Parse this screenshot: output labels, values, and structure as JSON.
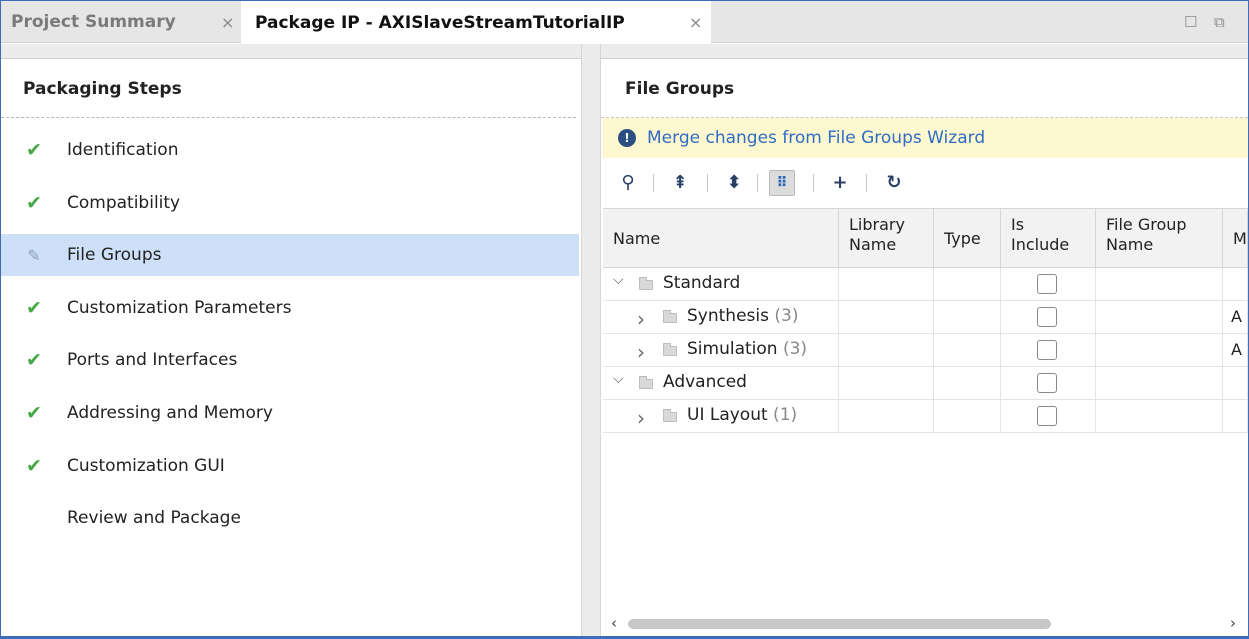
{
  "tabs": [
    {
      "label": "Project Summary",
      "close": "×"
    },
    {
      "label": "Package IP - AXISlaveStreamTutorialIP",
      "close": "×"
    }
  ],
  "window_controls": {
    "maximize": "☐",
    "restore": "⧉"
  },
  "left_panel": {
    "title": "Packaging Steps",
    "steps": [
      {
        "label": "Identification",
        "status": "done",
        "icon": "check-icon"
      },
      {
        "label": "Compatibility",
        "status": "done",
        "icon": "check-icon"
      },
      {
        "label": "File Groups",
        "status": "active",
        "icon": "edit-icon"
      },
      {
        "label": "Customization Parameters",
        "status": "done",
        "icon": "check-icon"
      },
      {
        "label": "Ports and Interfaces",
        "status": "done",
        "icon": "check-icon"
      },
      {
        "label": "Addressing and Memory",
        "status": "done",
        "icon": "check-icon"
      },
      {
        "label": "Customization GUI",
        "status": "done",
        "icon": "check-icon"
      },
      {
        "label": "Review and Package",
        "status": "pending",
        "icon": ""
      }
    ],
    "glyphs": {
      "check": "✔",
      "edit": "✎"
    }
  },
  "right_panel": {
    "title": "File Groups",
    "banner": {
      "icon": "!",
      "link": "Merge changes from File Groups Wizard"
    },
    "toolbar": [
      {
        "name": "search-icon",
        "glyph": "⚲"
      },
      {
        "name": "collapse-all-icon",
        "glyph": "⇞"
      },
      {
        "name": "expand-all-icon",
        "glyph": "⬍"
      },
      {
        "name": "hierarchy-icon",
        "glyph": "⠿",
        "pressed": true
      },
      {
        "name": "add-icon",
        "glyph": "+"
      },
      {
        "name": "refresh-icon",
        "glyph": "↻"
      }
    ],
    "table": {
      "columns": [
        "Name",
        "Library Name",
        "Type",
        "Is Include",
        "File Group Name",
        "M"
      ],
      "column_lines": [
        [
          "Name"
        ],
        [
          "Library",
          "Name"
        ],
        [
          "Type"
        ],
        [
          "Is",
          "Include"
        ],
        [
          "File Group",
          "Name"
        ],
        [
          "M"
        ]
      ],
      "rows": [
        {
          "name": "Standard",
          "count": "",
          "level": 0,
          "expander": "⌵",
          "last": ""
        },
        {
          "name": "Synthesis",
          "count": "(3)",
          "level": 1,
          "expander": "›",
          "last": "A"
        },
        {
          "name": "Simulation",
          "count": "(3)",
          "level": 1,
          "expander": "›",
          "last": "A"
        },
        {
          "name": "Advanced",
          "count": "",
          "level": 0,
          "expander": "⌵",
          "last": ""
        },
        {
          "name": "UI Layout",
          "count": "(1)",
          "level": 1,
          "expander": "›",
          "last": ""
        }
      ]
    },
    "scroll": {
      "left": "‹",
      "right": "›"
    }
  },
  "colors": {
    "accent": "#3d6cb8",
    "active_row": "#cde0f7",
    "check": "#46a746",
    "link": "#2f6cc5",
    "banner_bg": "#fdf8cf"
  }
}
